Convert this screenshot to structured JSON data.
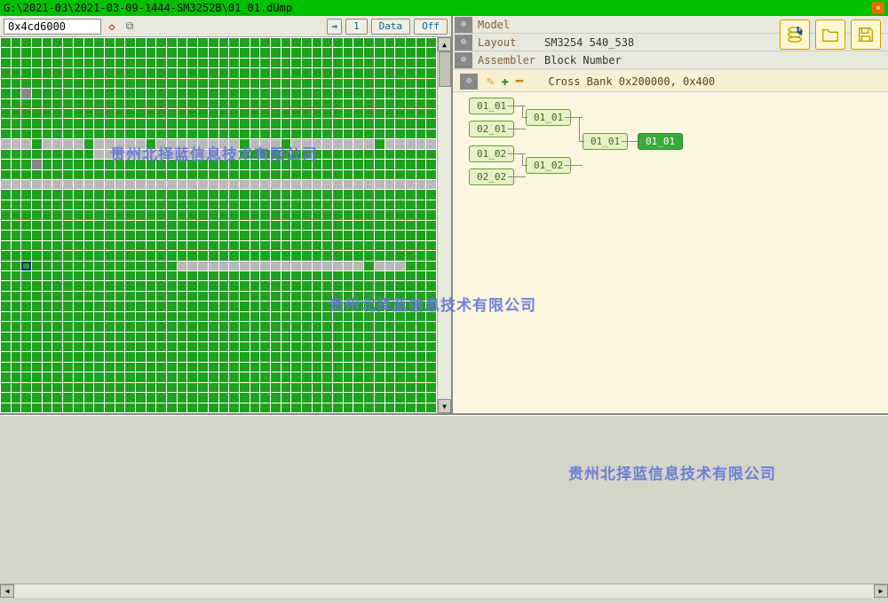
{
  "title": "G:\\2021-03\\2021-03-09-1444-SM3252B\\01_01.dUmp",
  "toolbar": {
    "address": "0x4cd6000",
    "btn_1": "1",
    "btn_data": "Data",
    "btn_off": "Off"
  },
  "props": {
    "model_label": "Model",
    "model_val": "",
    "layout_label": "Layout",
    "layout_val": "SM3254 540_538",
    "assembler_label": "Assembler",
    "assembler_val": "Block Number"
  },
  "tree": {
    "header": "Cross Bank 0x200000, 0x400",
    "nodes": {
      "n1": "01_01",
      "n2": "02_01",
      "n3": "01_02",
      "n4": "02_02",
      "n5": "01_01",
      "n6": "01_02",
      "n7": "01_01",
      "n8": "01_01"
    }
  },
  "watermark": "贵州北择蓝信息技术有限公司",
  "blockmap": {
    "cols": 42,
    "gray_rows": [
      10,
      11,
      14
    ],
    "gray_row10_green": [
      3,
      8,
      14,
      23,
      27,
      36
    ],
    "gray_row11_green": [
      0,
      1,
      2,
      3,
      4,
      5,
      6,
      7,
      8,
      23,
      24,
      25,
      26,
      27,
      28,
      29,
      30,
      31,
      32,
      33,
      34,
      35,
      36,
      37,
      38,
      39,
      40,
      41
    ],
    "row22_gray_ranges": [
      [
        17,
        34
      ],
      [
        36,
        38
      ]
    ],
    "dark_cells": [
      [
        5,
        2
      ],
      [
        12,
        3
      ]
    ],
    "selected": [
      22,
      2
    ]
  }
}
